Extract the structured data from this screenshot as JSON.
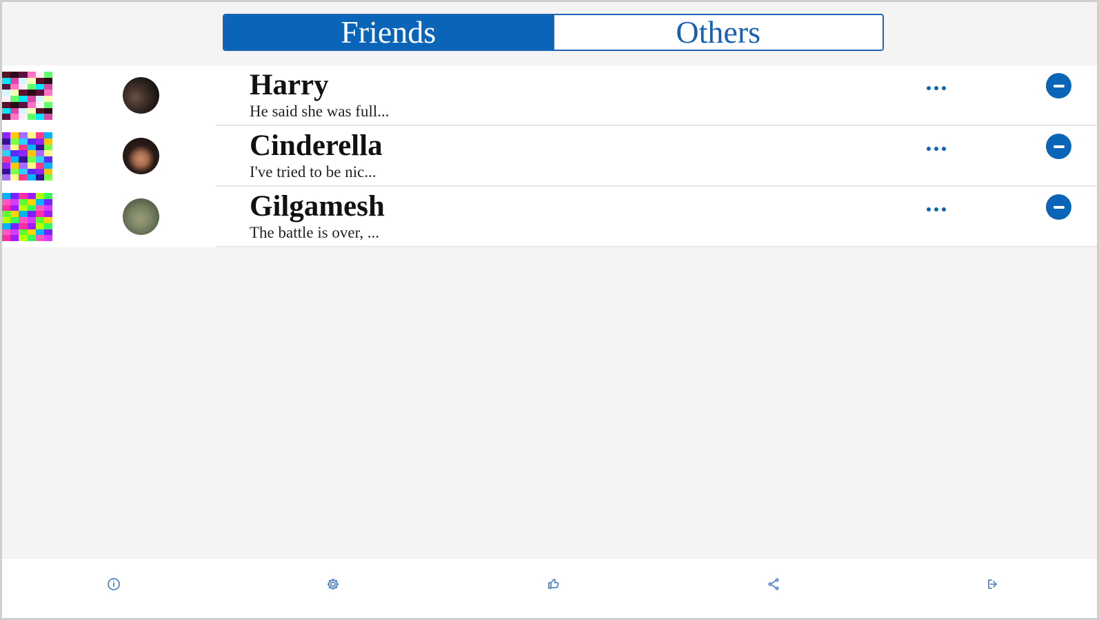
{
  "tabs": {
    "friends": "Friends",
    "others": "Others"
  },
  "contacts": [
    {
      "name": "Harry",
      "preview": "He said she was full..."
    },
    {
      "name": "Cinderella",
      "preview": "I've tried to be nic..."
    },
    {
      "name": "Gilgamesh",
      "preview": "The battle is over, ..."
    }
  ],
  "bottom_nav": {
    "icons": [
      "info-icon",
      "gear-icon",
      "thumbs-up-icon",
      "share-icon",
      "logout-icon"
    ]
  },
  "colors": {
    "accent": "#0a64b8",
    "background": "#f4f4f4",
    "row_background": "#ffffff"
  }
}
